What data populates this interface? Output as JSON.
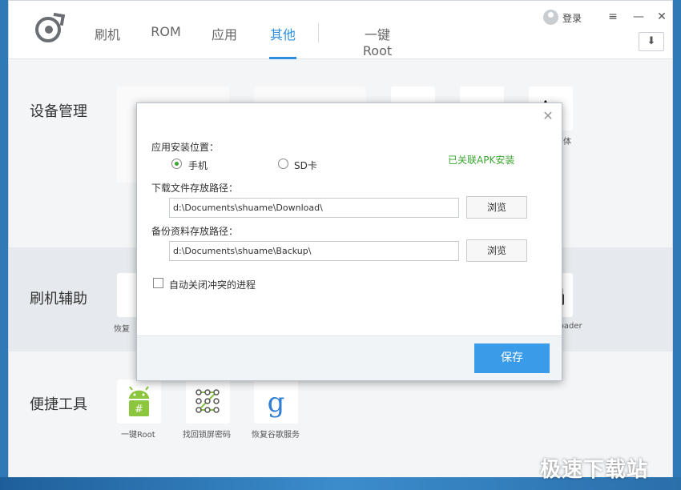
{
  "header": {
    "tabs": [
      {
        "label": "刷机"
      },
      {
        "label": "ROM"
      },
      {
        "label": "应用"
      },
      {
        "label": "其他"
      },
      {
        "label": "一键Root"
      }
    ],
    "active_tab": "其他",
    "login_label": "登录",
    "menu_glyph": "≡",
    "minimize_glyph": "—",
    "close_glyph": "✕",
    "download_glyph": "⬇"
  },
  "sections": [
    {
      "title": "设备管理"
    },
    {
      "title": "刷机辅助"
    },
    {
      "title": "便捷工具"
    }
  ],
  "device_tiles": {
    "font_glyph": "Aa",
    "font_label_partial": "字体"
  },
  "flash_tiles": {
    "left_label_partial": "恢复",
    "right_label_partial": "tloader"
  },
  "tools": [
    {
      "label": "一键Root",
      "icon": "android-root-icon"
    },
    {
      "label": "找回锁屏密码",
      "icon": "pattern-lock-icon"
    },
    {
      "label": "恢复谷歌服务",
      "icon": "google-g-icon"
    }
  ],
  "dialog": {
    "close_glyph": "✕",
    "install_location_label": "应用安装位置：",
    "radio_phone": "手机",
    "radio_sd": "SD卡",
    "apk_link": "已关联APK安装",
    "download_path_label": "下载文件存放路径：",
    "download_path_value": "d:\\Documents\\shuame\\Download\\",
    "backup_path_label": "备份资料存放路径：",
    "backup_path_value": "d:\\Documents\\shuame\\Backup\\",
    "browse_label": "浏览",
    "auto_close_label": "自动关闭冲突的进程",
    "save_label": "保存"
  },
  "watermark": "极速下载站",
  "colors": {
    "accent": "#2f8fdf",
    "save_button": "#3a9be8",
    "apk_link": "#3aa52f"
  }
}
